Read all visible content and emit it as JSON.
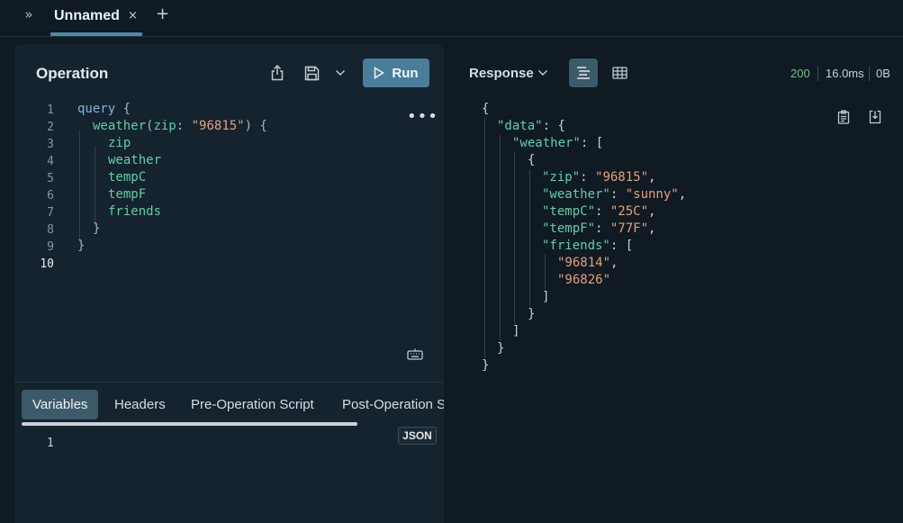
{
  "tabs": {
    "collapse_glyph": "»",
    "active_label": "Unnamed",
    "close_glyph": "×",
    "add_glyph": "+"
  },
  "operation": {
    "title": "Operation",
    "run_label": "Run",
    "more_glyph": "•••",
    "line_numbers": [
      "1",
      "2",
      "3",
      "4",
      "5",
      "6",
      "7",
      "8",
      "9",
      "10"
    ],
    "code": {
      "l1_kw": "query",
      "l1_brace": " {",
      "l2_fn": "weather",
      "l2_open": "(",
      "l2_arg": "zip",
      "l2_colon": ": ",
      "l2_str": "\"96815\"",
      "l2_close": ") {",
      "l3": "zip",
      "l4": "weather",
      "l5": "tempC",
      "l6": "tempF",
      "l7": "friends",
      "l8": "}",
      "l9": "}"
    }
  },
  "subtabs": {
    "variables": "Variables",
    "headers": "Headers",
    "pre_script": "Pre-Operation Script",
    "post_script": "Post-Operation Script",
    "json_badge": "JSON",
    "var_line_number": "1"
  },
  "response": {
    "label": "Response",
    "status_code": "200",
    "time": "16.0ms",
    "size": "0B",
    "lines": {
      "r1": "{",
      "r2_key": "\"data\"",
      "r2_rest": ": {",
      "r3_key": "\"weather\"",
      "r3_rest": ": [",
      "r4": "{",
      "r5_key": "\"zip\"",
      "r5_val": "\"96815\"",
      "r6_key": "\"weather\"",
      "r6_val": "\"sunny\"",
      "r7_key": "\"tempC\"",
      "r7_val": "\"25C\"",
      "r8_key": "\"tempF\"",
      "r8_val": "\"77F\"",
      "r9_key": "\"friends\"",
      "r9_rest": ": [",
      "r10_val": "\"96814\"",
      "r11_val": "\"96826\"",
      "r12": "]",
      "r13": "}",
      "r14": "]",
      "r15": "}",
      "r16": "}",
      "colon": ": ",
      "comma": ","
    }
  },
  "colors": {
    "background": "#0f1a22",
    "panel": "#14232d",
    "accent": "#4a7d99",
    "keyword": "#7fb4e6",
    "field": "#5fd0a8",
    "string": "#e89f7a",
    "status_ok": "#77c28d"
  }
}
